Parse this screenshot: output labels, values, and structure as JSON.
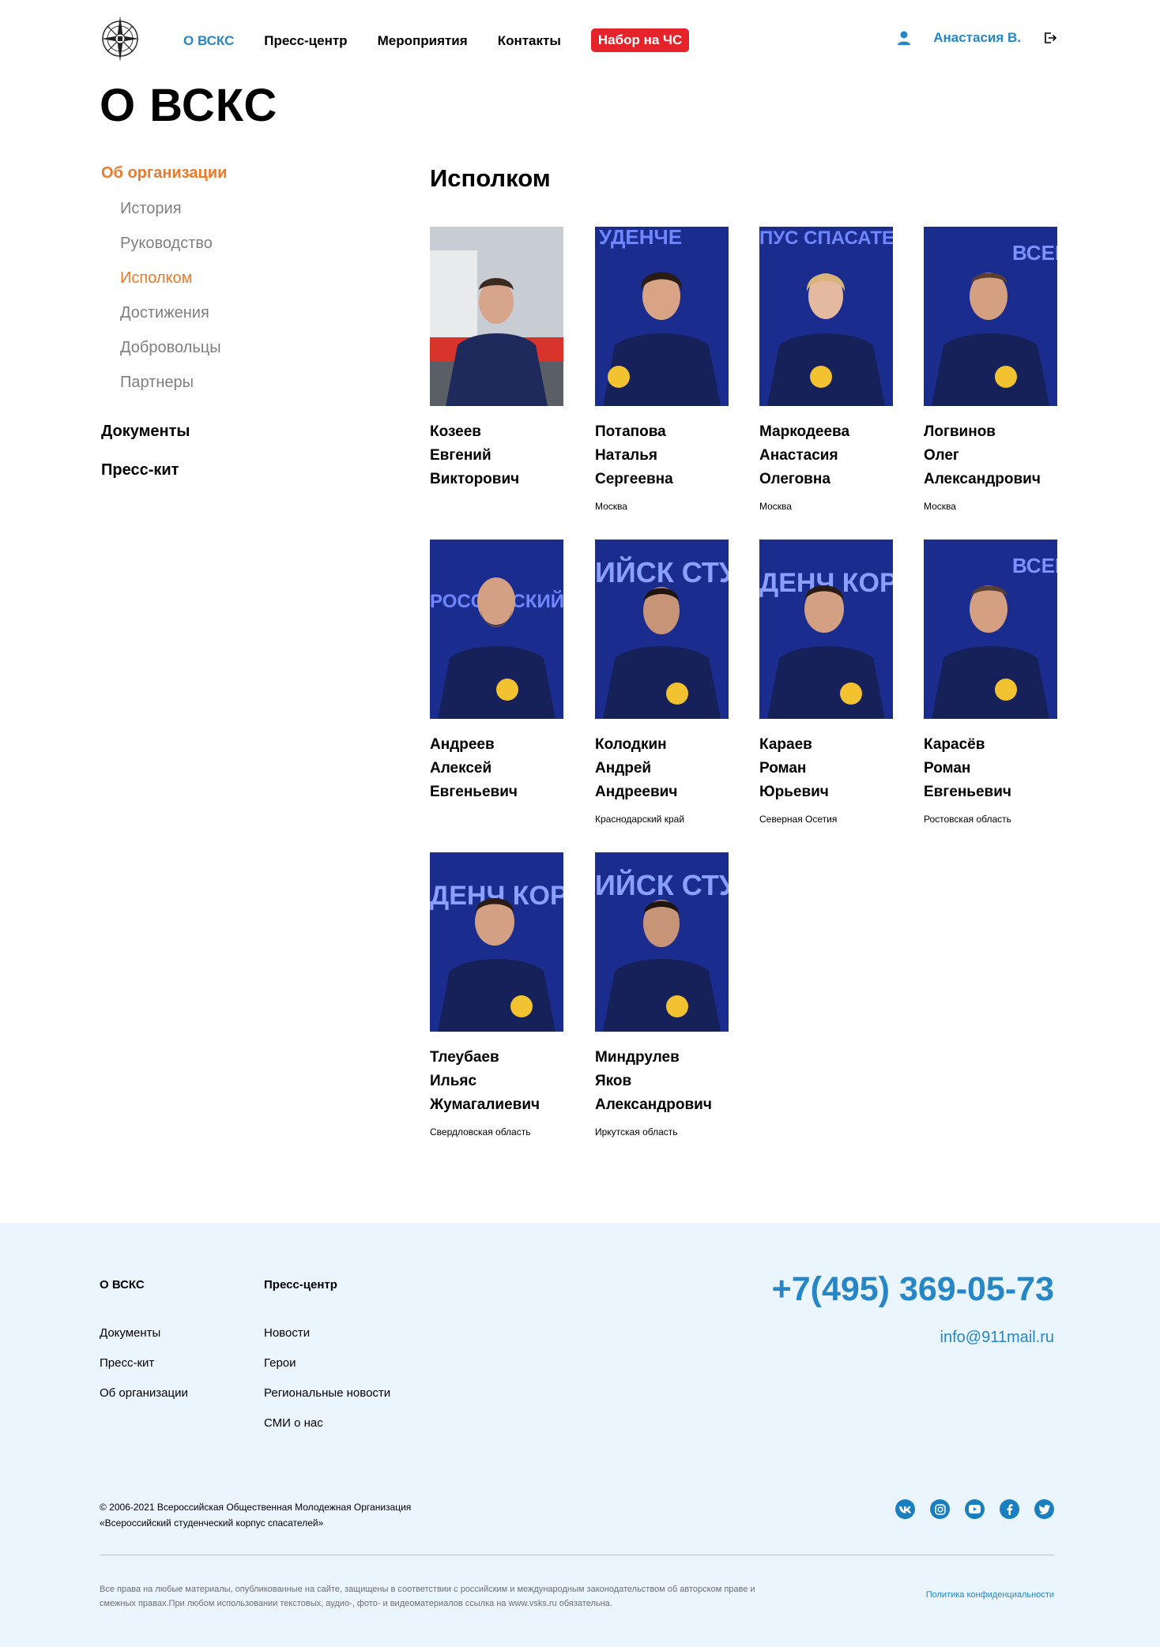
{
  "header": {
    "nav": [
      {
        "label": "О ВСКС",
        "active": true
      },
      {
        "label": "Пресс-центр",
        "active": false
      },
      {
        "label": "Мероприятия",
        "active": false
      },
      {
        "label": "Контакты",
        "active": false
      },
      {
        "label": "Набор на ЧС",
        "active": false,
        "badge": true
      }
    ],
    "user_name": "Анастасия В."
  },
  "page_title": "О ВСКС",
  "sidebar": {
    "section1": "Об организации",
    "items": [
      {
        "label": "История",
        "active": false
      },
      {
        "label": "Руководство",
        "active": false
      },
      {
        "label": "Исполком",
        "active": true
      },
      {
        "label": "Достижения",
        "active": false
      },
      {
        "label": "Добровольцы",
        "active": false
      },
      {
        "label": "Партнеры",
        "active": false
      }
    ],
    "section2": "Документы",
    "section3": "Пресс-кит"
  },
  "main": {
    "title": "Исполком",
    "members": [
      {
        "surname": "Козеев",
        "name": "Евгений",
        "patronymic": "Викторович",
        "region": ""
      },
      {
        "surname": "Потапова",
        "name": "Наталья",
        "patronymic": "Сергеевна",
        "region": "Москва"
      },
      {
        "surname": "Маркодеева",
        "name": "Анастасия",
        "patronymic": "Олеговна",
        "region": "Москва"
      },
      {
        "surname": "Логвинов",
        "name": "Олег",
        "patronymic": "Александрович",
        "region": "Москва"
      },
      {
        "surname": "Андреев",
        "name": "Алексей",
        "patronymic": "Евгеньевич",
        "region": ""
      },
      {
        "surname": "Колодкин",
        "name": "Андрей",
        "patronymic": "Андреевич",
        "region": "Краснодарский край"
      },
      {
        "surname": "Караев",
        "name": "Роман",
        "patronymic": "Юрьевич",
        "region": "Северная Осетия"
      },
      {
        "surname": "Карасёв",
        "name": "Роман",
        "patronymic": "Евгеньевич",
        "region": "Ростовская область"
      },
      {
        "surname": "Тлеубаев",
        "name": "Ильяс",
        "patronymic": "Жумагалиевич",
        "region": "Свердловская область"
      },
      {
        "surname": "Миндрулев",
        "name": "Яков",
        "patronymic": "Александрович",
        "region": "Иркутская область"
      }
    ]
  },
  "footer": {
    "col1": {
      "head": "О ВСКС",
      "links": [
        "Документы",
        "Пресс-кит",
        "Об организации"
      ]
    },
    "col2": {
      "head": "Пресс-центр",
      "links": [
        "Новости",
        "Герои",
        "Региональные новости",
        "СМИ о нас"
      ]
    },
    "phone": "+7(495) 369-05-73",
    "email": "info@911mail.ru",
    "copyright_line1": "© 2006-2021 Всероссийская Общественная Молодежная Организация",
    "copyright_line2": "«Всероссийский студенческий корпус спасателей»",
    "rights_line1": "Все права на любые материалы, опубликованные на сайте, защищены в соответствии с российским и международным законодательством об авторском праве и",
    "rights_line2": "смежных правах.При любом использовании текстовых, аудио-, фото- и видеоматериалов ссылка на www.vsks.ru обязательна.",
    "policy": "Политика конфиденциальности",
    "socials": [
      "vk-icon",
      "instagram-icon",
      "youtube-icon",
      "facebook-icon",
      "twitter-icon"
    ]
  },
  "colors": {
    "accent_blue": "#2787c6",
    "accent_orange": "#ec7a2b",
    "badge_red": "#e4242a",
    "footer_bg": "#eaf5fd",
    "photo_bg": "#1b2c8f"
  }
}
